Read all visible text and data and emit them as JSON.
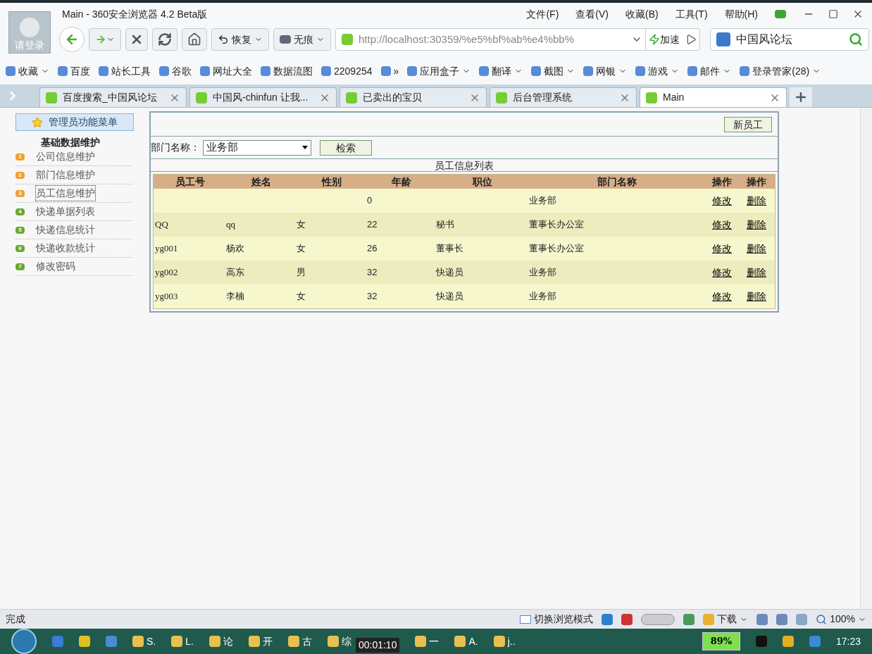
{
  "window": {
    "title": "Main - 360安全浏览器 4.2 Beta版",
    "user_label": "请登录",
    "menu": [
      "文件(F)",
      "查看(V)",
      "收藏(B)",
      "工具(T)",
      "帮助(H)"
    ]
  },
  "toolbar": {
    "restore": "恢复",
    "private": "无痕",
    "address": "http://localhost:30359/%e5%bf%ab%e4%bb%",
    "accelerate": "加速",
    "search_value": "中国风论坛"
  },
  "bookmarks": [
    {
      "label": "收藏",
      "dropdown": true
    },
    {
      "label": "百度",
      "dropdown": false
    },
    {
      "label": "站长工具",
      "dropdown": false
    },
    {
      "label": "谷歌",
      "dropdown": false
    },
    {
      "label": "网址大全",
      "dropdown": false
    },
    {
      "label": "数据流图",
      "dropdown": false
    },
    {
      "label": "2209254",
      "dropdown": false
    },
    {
      "label": "»",
      "dropdown": false
    },
    {
      "label": "应用盒子",
      "dropdown": true
    },
    {
      "label": "翻译",
      "dropdown": true
    },
    {
      "label": "截图",
      "dropdown": true
    },
    {
      "label": "网银",
      "dropdown": true
    },
    {
      "label": "游戏",
      "dropdown": true
    },
    {
      "label": "邮件",
      "dropdown": true
    },
    {
      "label": "登录管家(28)",
      "dropdown": true
    }
  ],
  "tabs": [
    {
      "label": "百度搜索_中国风论坛",
      "selected": false
    },
    {
      "label": "中国风-chinfun 让我...",
      "selected": false
    },
    {
      "label": "已卖出的宝贝",
      "selected": false
    },
    {
      "label": "后台管理系统",
      "selected": false
    },
    {
      "label": "Main",
      "selected": true
    }
  ],
  "sidebar": {
    "header": "管理员功能菜单",
    "section": "基础数据维护",
    "items": [
      {
        "badge": "1",
        "label": "公司信息维护",
        "color": "#f0a030",
        "selected": false
      },
      {
        "badge": "2",
        "label": "部门信息维护",
        "color": "#f0a030",
        "selected": false
      },
      {
        "badge": "3",
        "label": "员工信息维护",
        "color": "#f0a030",
        "selected": true
      },
      {
        "badge": "4",
        "label": "快递单据列表",
        "color": "#6aa830",
        "selected": false
      },
      {
        "badge": "5",
        "label": "快递信息统计",
        "color": "#6aa830",
        "selected": false
      },
      {
        "badge": "6",
        "label": "快递收款统计",
        "color": "#6aa830",
        "selected": false
      },
      {
        "badge": "7",
        "label": "修改密码",
        "color": "#6aa830",
        "selected": false
      }
    ]
  },
  "content": {
    "new_button": "新员工",
    "filter_label": "部门名称：",
    "department": "业务部",
    "search_button": "检索",
    "table_title": "员工信息列表",
    "columns": [
      "员工号",
      "姓名",
      "性别",
      "年龄",
      "职位",
      "部门名称",
      "操作",
      "操作"
    ],
    "rows": [
      {
        "id": "",
        "name": "",
        "gender": "",
        "age": "0",
        "position": "",
        "department": "业务部",
        "edit": "修改",
        "delete": "删除"
      },
      {
        "id": "QQ",
        "name": "qq",
        "gender": "女",
        "age": "22",
        "position": "秘书",
        "department": "董事长办公室",
        "edit": "修改",
        "delete": "删除"
      },
      {
        "id": "yg001",
        "name": "杨欢",
        "gender": "女",
        "age": "26",
        "position": "董事长",
        "department": "董事长办公室",
        "edit": "修改",
        "delete": "删除"
      },
      {
        "id": "yg002",
        "name": "高东",
        "gender": "男",
        "age": "32",
        "position": "快递员",
        "department": "业务部",
        "edit": "修改",
        "delete": "删除"
      },
      {
        "id": "yg003",
        "name": "李楠",
        "gender": "女",
        "age": "32",
        "position": "快递员",
        "department": "业务部",
        "edit": "修改",
        "delete": "删除"
      }
    ]
  },
  "status_bar": {
    "text": "完成",
    "mode": "切换浏览模式",
    "download": "下载",
    "zoom": "100%"
  },
  "taskbar": {
    "items": [
      "S.",
      "L.",
      "论",
      "开",
      "古",
      "综",
      "一",
      "A.",
      "j.."
    ],
    "timer": "00:01:10",
    "battery": "89%",
    "clock": "17:23"
  }
}
